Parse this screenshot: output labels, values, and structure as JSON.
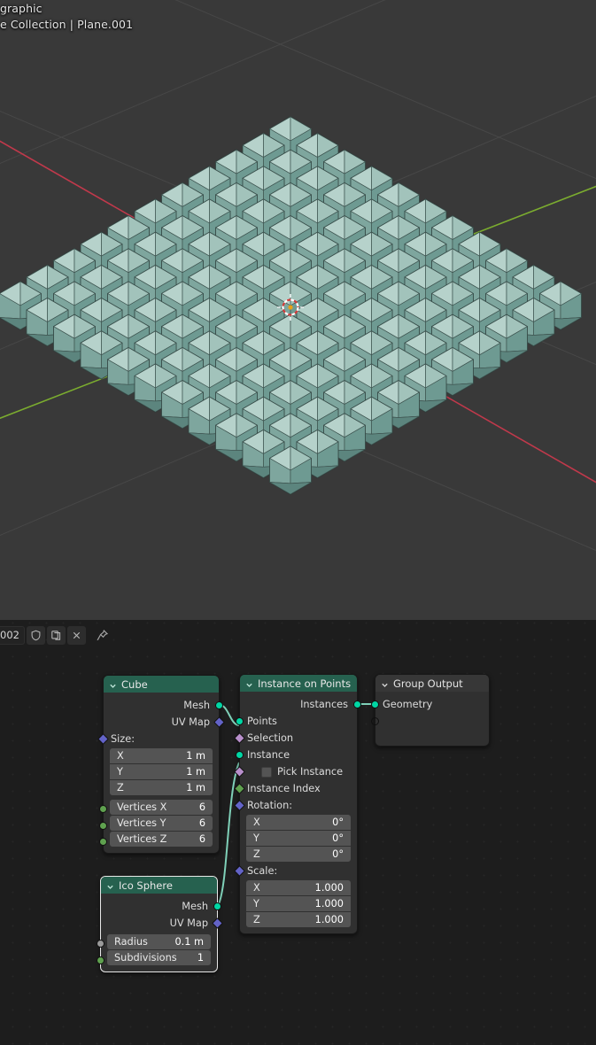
{
  "viewport": {
    "view_name": "graphic",
    "collection_text": "e Collection | Plane.001",
    "background_color": "#393939",
    "object_color": "#8fb5ad",
    "axis_x_color": "#c0394b",
    "axis_y_color": "#7bac2f",
    "cursor_name": "3d-cursor"
  },
  "node_editor": {
    "header": {
      "id_field_value": "002",
      "buttons": [
        {
          "name": "shield-icon",
          "label": "Shield"
        },
        {
          "name": "copy-icon",
          "label": "Copy"
        },
        {
          "name": "close-icon",
          "label": "X"
        }
      ],
      "pin_label": "Pin"
    },
    "nodes": [
      {
        "id": "cube",
        "title": "Cube",
        "header_color": "#26614f",
        "outputs": [
          {
            "label": "Mesh",
            "socket": "geometry"
          },
          {
            "label": "UV Map",
            "socket": "vector"
          }
        ],
        "size_label": "Size:",
        "size": [
          {
            "axis": "X",
            "value": "1 m"
          },
          {
            "axis": "Y",
            "value": "1 m"
          },
          {
            "axis": "Z",
            "value": "1 m"
          }
        ],
        "vertices": [
          {
            "label": "Vertices X",
            "value": "6"
          },
          {
            "label": "Vertices Y",
            "value": "6"
          },
          {
            "label": "Vertices Z",
            "value": "6"
          }
        ]
      },
      {
        "id": "icosphere",
        "title": "Ico Sphere",
        "header_color": "#26614f",
        "selected": true,
        "outputs": [
          {
            "label": "Mesh",
            "socket": "geometry"
          },
          {
            "label": "UV Map",
            "socket": "vector"
          }
        ],
        "fields": [
          {
            "label": "Radius",
            "value": "0.1 m"
          },
          {
            "label": "Subdivisions",
            "value": "1"
          }
        ]
      },
      {
        "id": "instance_on_points",
        "title": "Instance on Points",
        "header_color": "#26614f",
        "outputs": [
          {
            "label": "Instances",
            "socket": "geometry"
          }
        ],
        "inputs": [
          {
            "label": "Points",
            "socket": "geometry"
          },
          {
            "label": "Selection",
            "socket": "boolean"
          },
          {
            "label": "Instance",
            "socket": "geometry"
          },
          {
            "label": "Pick Instance",
            "socket": "boolean",
            "checkbox": false
          },
          {
            "label": "Instance Index",
            "socket": "integer"
          }
        ],
        "rotation_label": "Rotation:",
        "rotation": [
          {
            "axis": "X",
            "value": "0°"
          },
          {
            "axis": "Y",
            "value": "0°"
          },
          {
            "axis": "Z",
            "value": "0°"
          }
        ],
        "scale_label": "Scale:",
        "scale": [
          {
            "axis": "X",
            "value": "1.000"
          },
          {
            "axis": "Y",
            "value": "1.000"
          },
          {
            "axis": "Z",
            "value": "1.000"
          }
        ]
      },
      {
        "id": "group_output",
        "title": "Group Output",
        "header_color": "#373737",
        "inputs": [
          {
            "label": "Geometry",
            "socket": "geometry"
          },
          {
            "label": "",
            "socket": "empty"
          }
        ]
      }
    ]
  }
}
